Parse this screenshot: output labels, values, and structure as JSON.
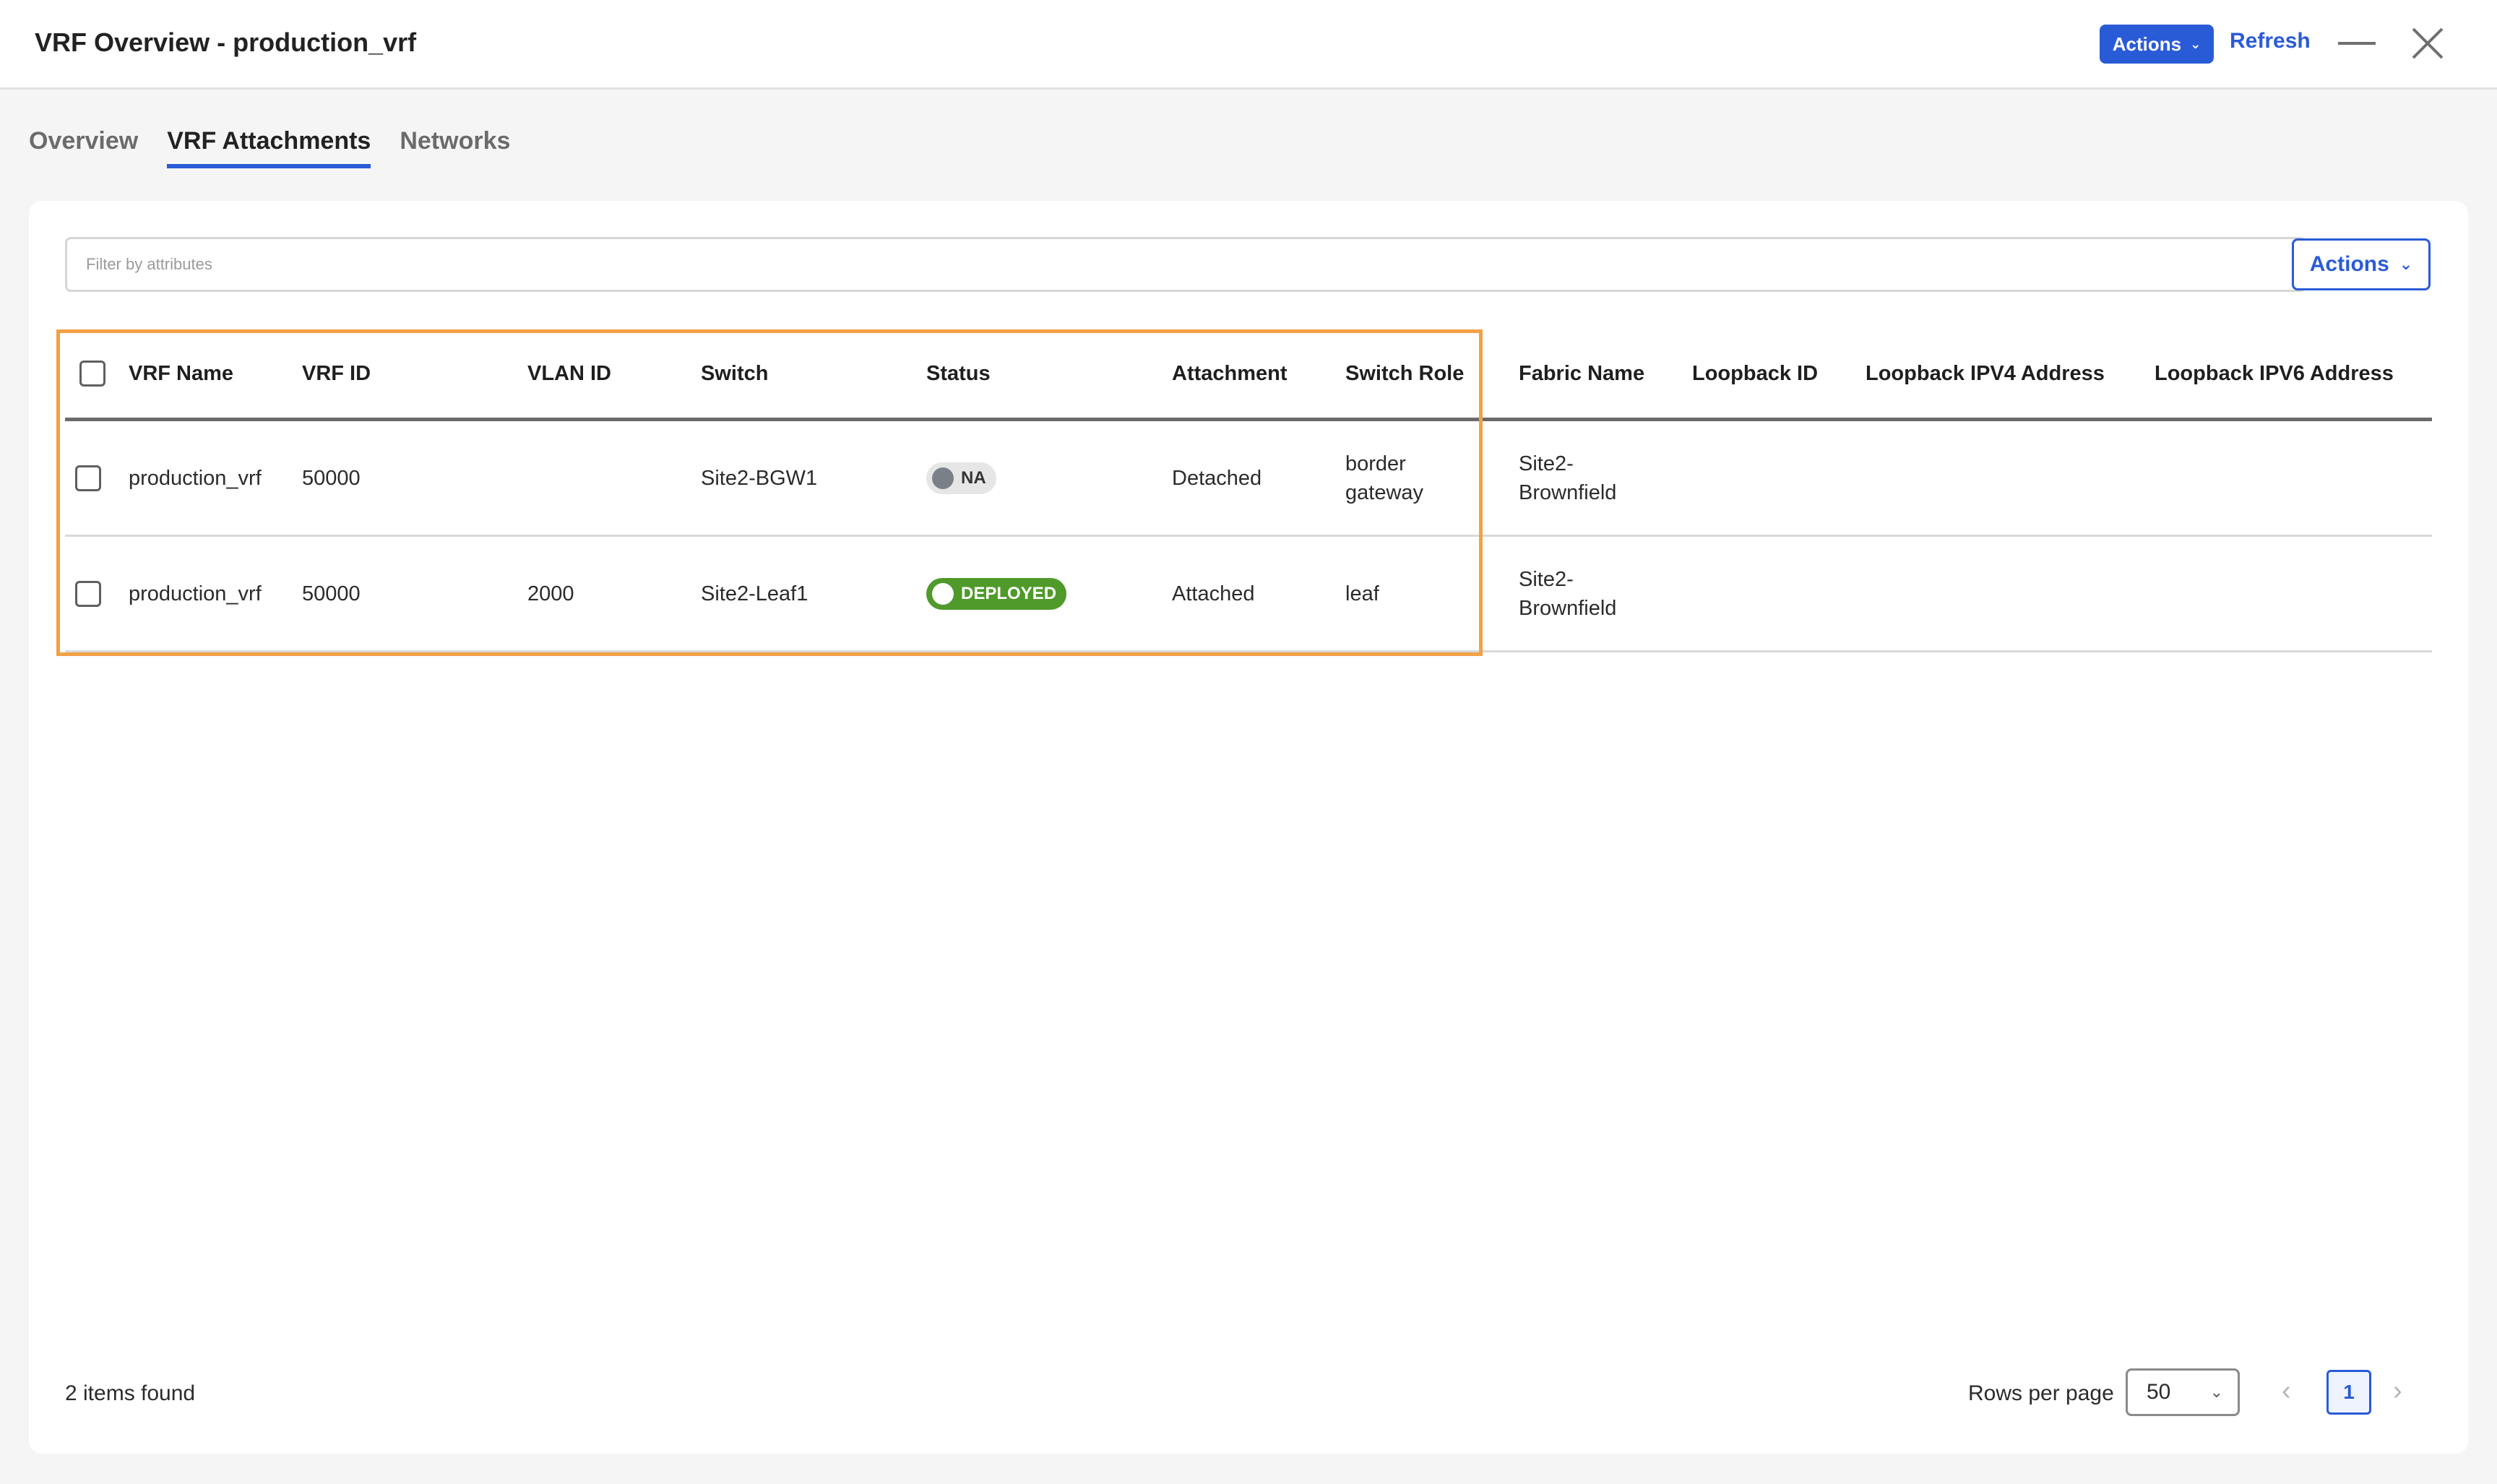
{
  "header": {
    "title": "VRF Overview - production_vrf",
    "actions_label": "Actions",
    "refresh_label": "Refresh",
    "accent_color": "#2a5bd7"
  },
  "tabs": [
    {
      "label": "Overview",
      "active": false
    },
    {
      "label": "VRF Attachments",
      "active": true
    },
    {
      "label": "Networks",
      "active": false
    }
  ],
  "filter": {
    "placeholder": "Filter by attributes",
    "value": ""
  },
  "card_actions_label": "Actions",
  "table": {
    "columns": [
      "VRF Name",
      "VRF ID",
      "VLAN ID",
      "Switch",
      "Status",
      "Attachment",
      "Switch Role",
      "Fabric Name",
      "Loopback ID",
      "Loopback IPV4 Address",
      "Loopback IPV6 Address"
    ],
    "rows": [
      {
        "vrf_name": "production_vrf",
        "vrf_id": "50000",
        "vlan_id": "",
        "switch": "Site2-BGW1",
        "status": "NA",
        "attachment": "Detached",
        "switch_role": "border gateway",
        "fabric_name": "Site2-Brownfield",
        "loopback_id": "",
        "loopback_ipv4": "",
        "loopback_ipv6": ""
      },
      {
        "vrf_name": "production_vrf",
        "vrf_id": "50000",
        "vlan_id": "2000",
        "switch": "Site2-Leaf1",
        "status": "DEPLOYED",
        "attachment": "Attached",
        "switch_role": "leaf",
        "fabric_name": "Site2-Brownfield",
        "loopback_id": "",
        "loopback_ipv4": "",
        "loopback_ipv6": ""
      }
    ]
  },
  "footer": {
    "items_found": "2 items found",
    "rows_per_page_label": "Rows per page",
    "rows_per_page_value": "50",
    "current_page": "1"
  },
  "icons": {
    "close": "close-icon",
    "minimize": "minimize-icon",
    "chevron_down": "chevron-down-icon",
    "prev": "chevron-left-icon",
    "next": "chevron-right-icon"
  },
  "colors": {
    "highlight_border": "#f2a146",
    "deployed_badge": "#4f9a2a",
    "na_badge": "#e6e6e6"
  }
}
